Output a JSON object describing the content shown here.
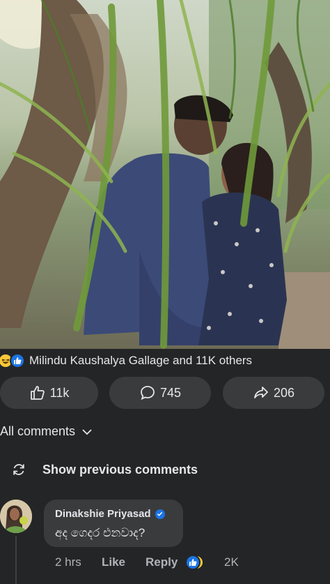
{
  "post": {
    "reactions": {
      "icons": [
        "laughing-emoji-icon",
        "like-reaction-icon"
      ],
      "summary": "Milindu Kaushalya Gallage and 11K others"
    },
    "actions": {
      "like_count": "11k",
      "comment_count": "745",
      "share_count": "206"
    }
  },
  "comments_section": {
    "filter_label": "All comments",
    "show_previous_label": "Show previous comments",
    "comments": [
      {
        "author": "Dinakshie Priyasad",
        "verified": true,
        "text": "අද ගෙදර එනවාද?",
        "time": "2 hrs",
        "like_label": "Like",
        "reply_label": "Reply",
        "reaction_count": "2K"
      }
    ]
  },
  "colors": {
    "background": "#242526",
    "pill": "#3a3b3c",
    "accent_blue": "#1b74e4",
    "emoji_yellow": "#f7c83b",
    "muted_text": "#b0b3b8"
  }
}
